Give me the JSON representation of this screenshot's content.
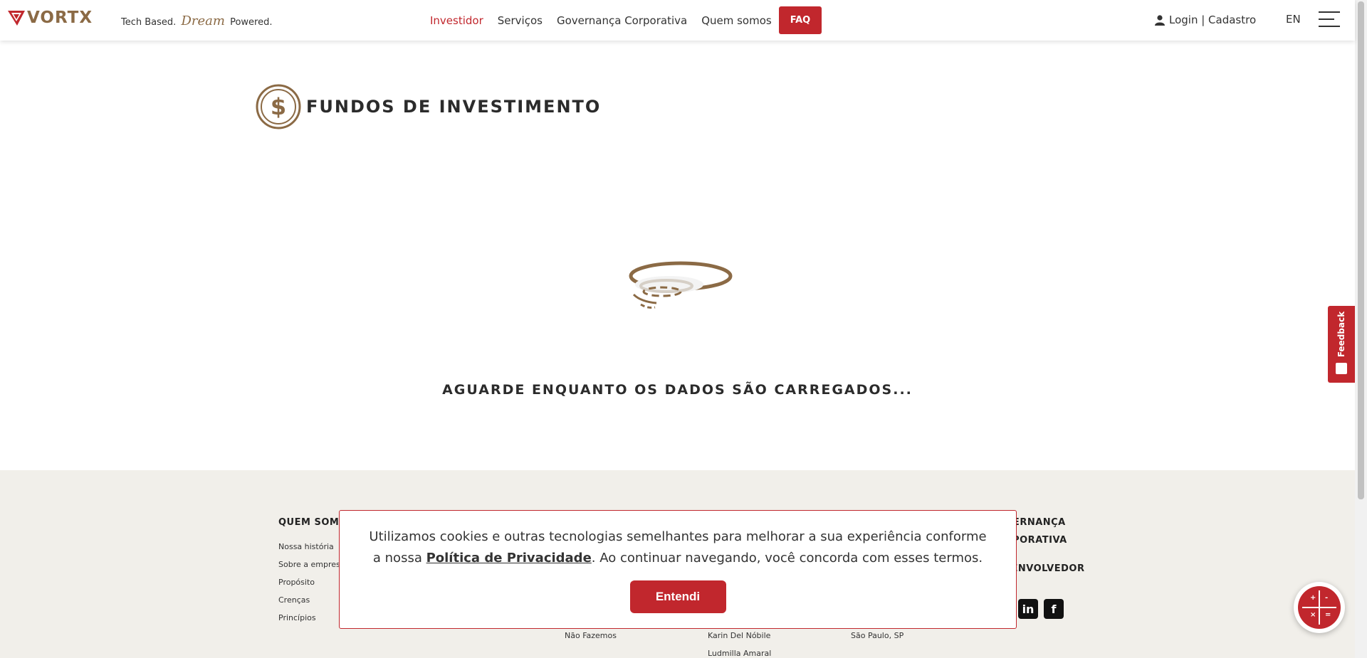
{
  "header": {
    "logo_text": "VORTX",
    "tagline_before": "Tech Based.",
    "tagline_script": "Dream",
    "tagline_after": "Powered.",
    "nav": [
      {
        "label": "Investidor",
        "active": true
      },
      {
        "label": "Serviços"
      },
      {
        "label": "Governança Corporativa"
      },
      {
        "label": "Quem somos"
      }
    ],
    "faq_label": "FAQ",
    "login_label": "Login | Cadastro",
    "lang_label": "EN",
    "icons": {
      "user": "user-icon",
      "menu": "hamburger-menu-icon"
    }
  },
  "main": {
    "title": "FUNDOS DE INVESTIMENTO",
    "title_icon": "dollar-coin-icon",
    "loading_text": "AGUARDE ENQUANTO OS DADOS SÃO CARREGADOS..."
  },
  "footer": {
    "col1_title": "QUEM SOMOS",
    "col1_links": [
      "Nossa história",
      "Sobre a empresa",
      "Propósito",
      "Crenças",
      "Princípios"
    ],
    "col2_link": "Não Fazemos",
    "col3_links": [
      "Karin Del Nóbile",
      "Ludmilla Amaral"
    ],
    "col4_link": "São Paulo, SP",
    "col5_title_1": "GOVERNANÇA",
    "col5_title_2": "CORPORATIVA",
    "col5_title_3": "DESENVOLVEDOR",
    "social": [
      "linkedin-icon",
      "facebook-icon"
    ]
  },
  "cookie": {
    "text_before": "Utilizamos cookies e outras tecnologias semelhantes para melhorar a sua experiência conforme a nossa ",
    "link_text": "Política de Privacidade",
    "text_after": ". Ao continuar navegando, você concorda com esses termos.",
    "button_label": "Entendi"
  },
  "feedback_label": "Feedback",
  "colors": {
    "brand_red": "#c1272d",
    "brand_gold": "#8b6a45",
    "footer_bg": "#f1efea"
  }
}
